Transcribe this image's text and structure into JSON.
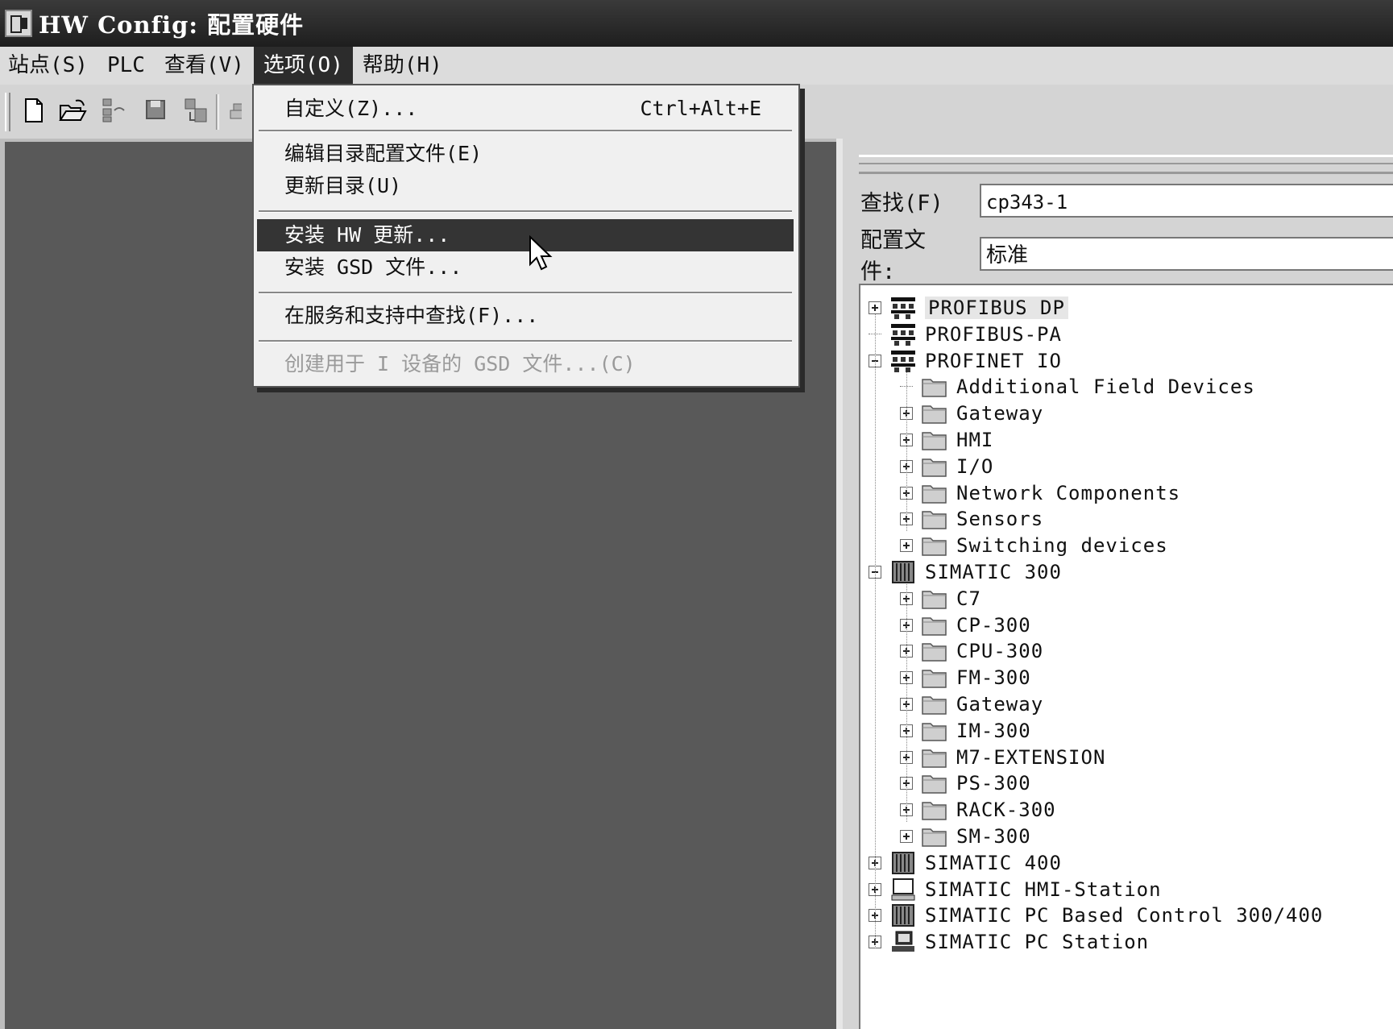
{
  "window": {
    "title": "HW Config: 配置硬件"
  },
  "menubar": {
    "items": [
      {
        "label": "站点(S)"
      },
      {
        "label": "PLC"
      },
      {
        "label": "查看(V)"
      },
      {
        "label": "选项(O)"
      },
      {
        "label": "帮助(H)"
      }
    ],
    "active_index": 3
  },
  "options_menu": {
    "items": [
      {
        "label": "自定义(Z)...",
        "shortcut": "Ctrl+Alt+E"
      },
      {
        "label": "编辑目录配置文件(E)"
      },
      {
        "label": "更新目录(U)"
      },
      {
        "label": "安装 HW 更新..."
      },
      {
        "label": "安装 GSD 文件..."
      },
      {
        "label": "在服务和支持中查找(F)..."
      },
      {
        "label": "创建用于 I 设备的 GSD 文件...(C)"
      }
    ],
    "highlighted_index": 3,
    "disabled_index": 6
  },
  "toolbar": {
    "icons": [
      "new-icon",
      "open-icon",
      "network-icon",
      "save-icon",
      "download-icon",
      "print-icon"
    ]
  },
  "catalog": {
    "search_label": "查找(F)",
    "search_value": "cp343-1",
    "profile_label": "配置文件:",
    "profile_value": "标准",
    "tree": [
      {
        "label": "PROFIBUS DP",
        "icon": "bus-icon",
        "expander": "plus",
        "level": 0
      },
      {
        "label": "PROFIBUS-PA",
        "icon": "bus-icon",
        "expander": "none",
        "level": 0
      },
      {
        "label": "PROFINET IO",
        "icon": "bus-icon",
        "expander": "minus",
        "level": 0
      },
      {
        "label": "Additional Field Devices",
        "icon": "folder-icon",
        "expander": "none",
        "level": 1
      },
      {
        "label": "Gateway",
        "icon": "folder-icon",
        "expander": "plus",
        "level": 1
      },
      {
        "label": "HMI",
        "icon": "folder-icon",
        "expander": "plus",
        "level": 1
      },
      {
        "label": "I/O",
        "icon": "folder-icon",
        "expander": "plus",
        "level": 1
      },
      {
        "label": "Network Components",
        "icon": "folder-icon",
        "expander": "plus",
        "level": 1
      },
      {
        "label": "Sensors",
        "icon": "folder-icon",
        "expander": "plus",
        "level": 1
      },
      {
        "label": "Switching devices",
        "icon": "folder-icon",
        "expander": "plus",
        "level": 1
      },
      {
        "label": "SIMATIC 300",
        "icon": "plc-icon",
        "expander": "minus",
        "level": 0
      },
      {
        "label": "C7",
        "icon": "folder-icon",
        "expander": "plus",
        "level": 1
      },
      {
        "label": "CP-300",
        "icon": "folder-icon",
        "expander": "plus",
        "level": 1
      },
      {
        "label": "CPU-300",
        "icon": "folder-icon",
        "expander": "plus",
        "level": 1
      },
      {
        "label": "FM-300",
        "icon": "folder-icon",
        "expander": "plus",
        "level": 1
      },
      {
        "label": "Gateway",
        "icon": "folder-icon",
        "expander": "plus",
        "level": 1
      },
      {
        "label": "IM-300",
        "icon": "folder-icon",
        "expander": "plus",
        "level": 1
      },
      {
        "label": "M7-EXTENSION",
        "icon": "folder-icon",
        "expander": "plus",
        "level": 1
      },
      {
        "label": "PS-300",
        "icon": "folder-icon",
        "expander": "plus",
        "level": 1
      },
      {
        "label": "RACK-300",
        "icon": "folder-icon",
        "expander": "plus",
        "level": 1
      },
      {
        "label": "SM-300",
        "icon": "folder-icon",
        "expander": "plus",
        "level": 1
      },
      {
        "label": "SIMATIC 400",
        "icon": "plc-icon",
        "expander": "plus",
        "level": 0
      },
      {
        "label": "SIMATIC HMI-Station",
        "icon": "monitor-icon",
        "expander": "plus",
        "level": 0
      },
      {
        "label": "SIMATIC PC Based Control 300/400",
        "icon": "plc-icon",
        "expander": "plus",
        "level": 0
      },
      {
        "label": "SIMATIC PC Station",
        "icon": "pc-station-icon",
        "expander": "plus",
        "level": 0
      }
    ]
  }
}
